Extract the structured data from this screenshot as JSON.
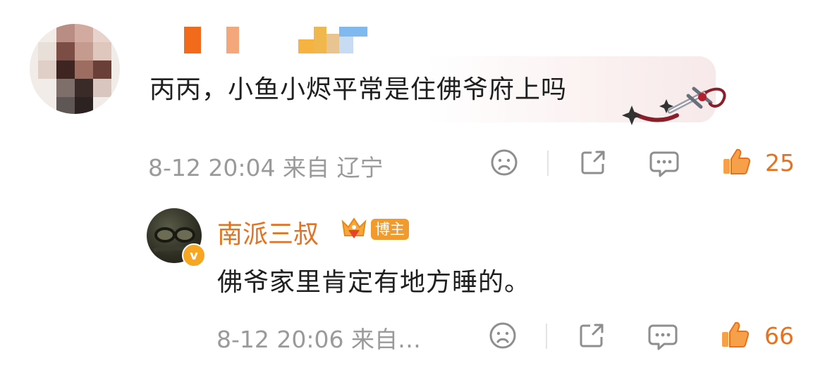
{
  "comment": {
    "text": "丙丙，小鱼小烬平常是住佛爷府上吗",
    "time": "8-12 20:04",
    "source": "来自 辽宁",
    "like_count": "25"
  },
  "reply": {
    "author": "南派三叔",
    "badge_label": "博主",
    "text": "佛爷家里肯定有地方睡的。",
    "time": "8-12 20:06",
    "source": "来自…",
    "like_count": "66"
  },
  "colors": {
    "accent": "#e8711e",
    "meta_gray": "#9a9a9a",
    "icon_gray": "#8e8e8e",
    "verified": "#f6a623"
  },
  "icons": [
    "emoji-face-icon",
    "share-icon",
    "comment-icon",
    "thumbs-up-icon",
    "verified-icon",
    "crown-icon",
    "sword-decoration-icon"
  ]
}
